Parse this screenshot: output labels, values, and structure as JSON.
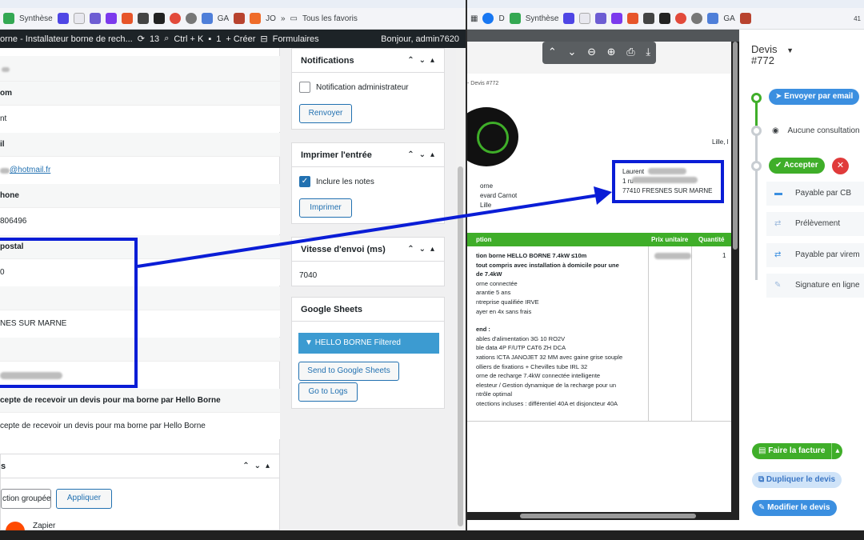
{
  "left_browser": {
    "bookmarks": [
      "Synthèse",
      "GA",
      "JO",
      "Tous les favoris"
    ],
    "admin_bar": {
      "site": "orne - Installateur borne de rech...",
      "updates": "13",
      "shortcut": "Ctrl + K",
      "comments": "1",
      "new": "+ Créer",
      "forms": "Formulaires",
      "greeting": "Bonjour, admin7620"
    }
  },
  "entry": {
    "rows": [
      {
        "label": "",
        "value": ""
      },
      {
        "label": "om",
        "value": "nt"
      },
      {
        "label": "il",
        "value": "@hotmail.fr"
      },
      {
        "label": "hone",
        "value": "806496"
      },
      {
        "label": "postal",
        "value": "0"
      },
      {
        "label": "",
        "value": "NES SUR MARNE"
      },
      {
        "label": "",
        "value": ""
      }
    ],
    "consent_label": "cepte de recevoir un devis pour ma borne par Hello Borne",
    "consent_value": "cepte de recevoir un devis pour ma borne par Hello Borne",
    "bulk_section_title": "s",
    "bulk_select": "ction groupée",
    "apply": "Appliquer",
    "zapier": "Zapier"
  },
  "notifications": {
    "title": "Notifications",
    "checkbox": "Notification administrateur",
    "button": "Renvoyer"
  },
  "print": {
    "title": "Imprimer l'entrée",
    "checkbox": "Inclure les notes",
    "button": "Imprimer"
  },
  "speed": {
    "title": "Vitesse d'envoi (ms)",
    "value": "7040"
  },
  "sheets": {
    "title": "Google Sheets",
    "filter": "HELLO BORNE Filtered",
    "send": "Send to Google Sheets",
    "logs": "Go to Logs"
  },
  "right_browser": {
    "bookmarks": [
      "D",
      "Synthèse",
      "GA",
      "41"
    ]
  },
  "pdf": {
    "breadcrumb": "- Devis #772",
    "city": "Lille, l",
    "sender_lines": [
      "orne",
      "evard Carnot",
      "Lille"
    ],
    "client": {
      "name": "Laurent",
      "street": "1 ru",
      "city": "77410 FRESNES SUR MARNE"
    },
    "table_headers": [
      "ption",
      "Prix unitaire",
      "Quantité"
    ],
    "qty": "1",
    "lines": [
      "tion borne HELLO BORNE 7.4kW ≤10m",
      "tout compris avec installation à domicile pour une",
      "de 7.4kW",
      "orne connectée",
      "arantie 5 ans",
      "ntreprise qualifiée IRVE",
      "ayer en 4x sans frais",
      "",
      "end :",
      "ables d'alimentation 3G 10 RO2V",
      "ble data 4P F/UTP CAT6 ZH DCA",
      "xations ICTA JANOJET 32 MM avec gaine grise souple",
      "olliers de fixations + Chevilles tube IRL 32",
      "orne de recharge 7.4kW connectée intelligente",
      "elesteur / Gestion dynamique de la recharge pour un",
      "ntrôle optimal",
      "otections incluses : différentiel 40A et disjoncteur 40A"
    ]
  },
  "devis": {
    "title": "Devis",
    "number": "#772",
    "email_btn": "Envoyer par email",
    "consultation": "Aucune consultation",
    "accept_btn": "Accepter",
    "payments": [
      "Payable par CB",
      "Prélèvement",
      "Payable par virem",
      "Signature en ligne"
    ],
    "invoice_btn": "Faire la facture",
    "duplicate_btn": "Dupliquer le devis",
    "edit_btn": "Modifier le devis"
  },
  "colors": {
    "wp_blue": "#2271b1",
    "annotation": "#0a1dd6",
    "green": "#3fae29",
    "chip_blue": "#3b8fe0"
  }
}
